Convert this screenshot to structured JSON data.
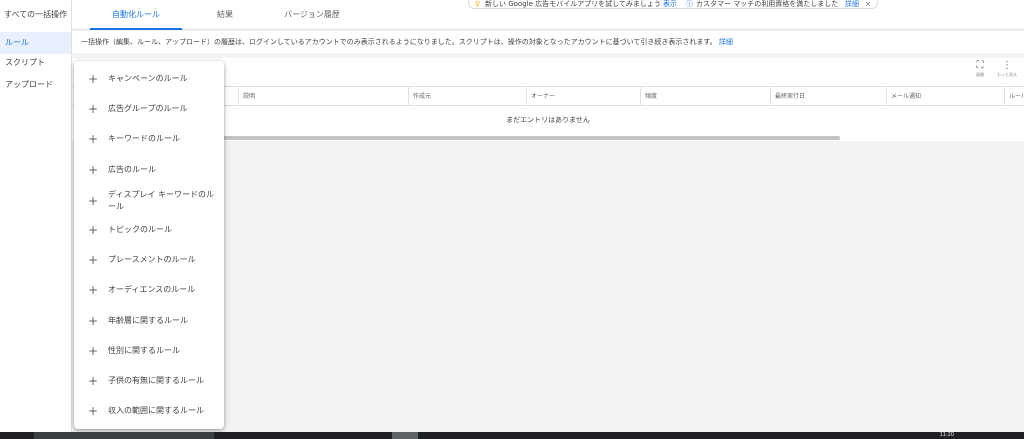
{
  "sidebar": {
    "all_bulk": "すべての一括操作",
    "items": [
      {
        "label": "ルール",
        "active": true
      },
      {
        "label": "スクリプト",
        "active": false
      },
      {
        "label": "アップロード",
        "active": false
      }
    ]
  },
  "tabs": [
    {
      "label": "自動化ルール",
      "active": true
    },
    {
      "label": "結果",
      "active": false
    },
    {
      "label": "バージョン履歴",
      "active": false
    }
  ],
  "notification": {
    "msg1": "新しい Google 広告モバイルアプリを試してみましょう",
    "link1": "表示",
    "msg2": "カスタマー マッチの利用資格を満たしました",
    "link2": "詳細",
    "close": "×"
  },
  "info": {
    "text": "一括操作（編集、ルール、アップロード）の履歴は、ログインしているアカウントでのみ表示されるようになりました。スクリプトは、操作の対象となったアカウントに基づいて引き続き表示されます。",
    "link": "詳細"
  },
  "toolbar": {
    "expand_label": "展開",
    "more_label": "もっと見る"
  },
  "table": {
    "headers": [
      "説明",
      "作成元",
      "オーナー",
      "頻度",
      "最終実行日",
      "メール通知",
      "ルール"
    ],
    "empty": "まだエントリはありません"
  },
  "dropdown": {
    "items": [
      "キャンペーンのルール",
      "広告グループのルール",
      "キーワードのルール",
      "広告のルール",
      "ディスプレイ キーワードのルール",
      "トピックのルール",
      "プレースメントのルール",
      "オーディエンスのルール",
      "年齢層に関するルール",
      "性別に関するルール",
      "子供の有無に関するルール",
      "収入の範囲に関するルール"
    ]
  },
  "taskbar": {
    "clock": "11:20"
  }
}
